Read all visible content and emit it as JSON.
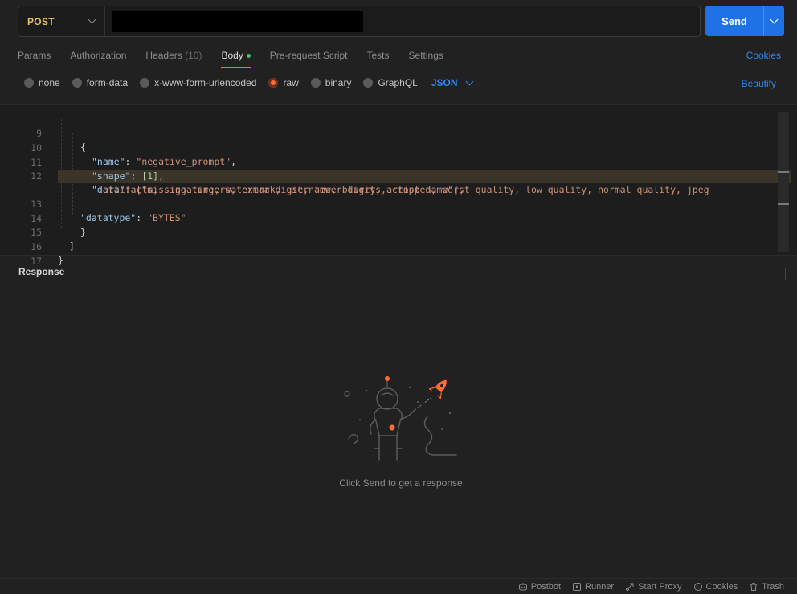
{
  "request": {
    "method": "POST",
    "send_label": "Send"
  },
  "tabs": [
    {
      "label": "Params"
    },
    {
      "label": "Authorization"
    },
    {
      "label": "Headers",
      "count": "(10)"
    },
    {
      "label": "Body"
    },
    {
      "label": "Pre-request Script"
    },
    {
      "label": "Tests"
    },
    {
      "label": "Settings"
    }
  ],
  "cookies_link": "Cookies",
  "body_types": {
    "options": [
      "none",
      "form-data",
      "x-www-form-urlencoded",
      "raw",
      "binary",
      "GraphQL"
    ],
    "selected": "raw",
    "format": "JSON",
    "beautify": "Beautify"
  },
  "editor": {
    "lines": [
      {
        "n": "9",
        "text": "{"
      },
      {
        "n": "10",
        "key": "\"name\"",
        "value": "\"negative_prompt\"",
        "tail": ","
      },
      {
        "n": "11",
        "key": "\"shape\"",
        "value": "[1]",
        "tail": ","
      },
      {
        "n": "12",
        "key": "\"data\"",
        "value": "[\"missing fingers, extra digit, fewer digits, cropped, worst quality, low quality, normal quality, jpeg",
        "cont": "artifacts, signature, watermark, username, blurry, artist name\"],"
      },
      {
        "n": "13",
        "key": "\"datatype\"",
        "value": "\"BYTES\""
      },
      {
        "n": "14",
        "text": "}"
      },
      {
        "n": "15",
        "text": "]"
      },
      {
        "n": "16",
        "text": "}"
      },
      {
        "n": "17",
        "text": ""
      }
    ]
  },
  "response": {
    "title": "Response",
    "empty_message": "Click Send to get a response"
  },
  "statusbar": [
    {
      "label": "Postbot",
      "icon": "postbot-icon"
    },
    {
      "label": "Runner",
      "icon": "runner-icon"
    },
    {
      "label": "Start Proxy",
      "icon": "proxy-icon"
    },
    {
      "label": "Cookies",
      "icon": "cookie-icon"
    },
    {
      "label": "Trash",
      "icon": "trash-icon"
    }
  ],
  "colors": {
    "accent": "#ff6c37",
    "primary": "#1f72e6",
    "link": "#2f86f5",
    "method": "#e8c35c"
  }
}
